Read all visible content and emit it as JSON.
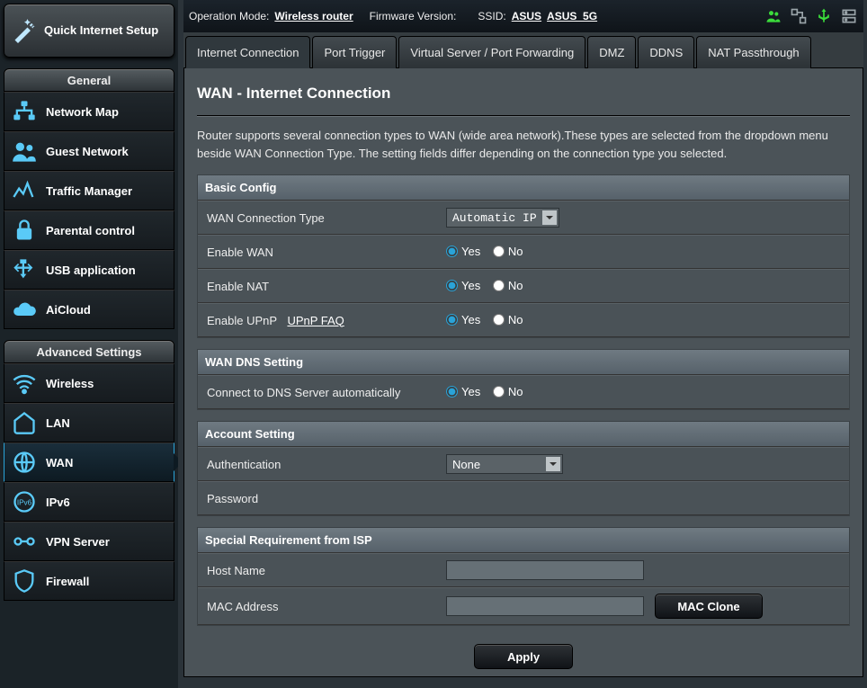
{
  "sidebar": {
    "qis_label": "Quick Internet Setup",
    "sections": {
      "general": {
        "title": "General",
        "items": [
          {
            "label": "Network Map",
            "icon": "network-map-icon"
          },
          {
            "label": "Guest Network",
            "icon": "guest-network-icon"
          },
          {
            "label": "Traffic Manager",
            "icon": "traffic-manager-icon"
          },
          {
            "label": "Parental control",
            "icon": "parental-control-icon"
          },
          {
            "label": "USB application",
            "icon": "usb-application-icon"
          },
          {
            "label": "AiCloud",
            "icon": "aicloud-icon"
          }
        ]
      },
      "advanced": {
        "title": "Advanced Settings",
        "items": [
          {
            "label": "Wireless",
            "icon": "wireless-icon"
          },
          {
            "label": "LAN",
            "icon": "lan-icon"
          },
          {
            "label": "WAN",
            "icon": "wan-icon",
            "active": true
          },
          {
            "label": "IPv6",
            "icon": "ipv6-icon"
          },
          {
            "label": "VPN Server",
            "icon": "vpn-server-icon"
          },
          {
            "label": "Firewall",
            "icon": "firewall-icon"
          }
        ]
      }
    }
  },
  "topbar": {
    "op_mode_label": "Operation Mode:",
    "op_mode_value": "Wireless router",
    "fw_label": "Firmware Version:",
    "ssid_label": "SSID:",
    "ssid_value_1": "ASUS",
    "ssid_value_2": "ASUS_5G"
  },
  "tabs": [
    {
      "label": "Internet Connection",
      "active": true
    },
    {
      "label": "Port Trigger"
    },
    {
      "label": "Virtual Server / Port Forwarding"
    },
    {
      "label": "DMZ"
    },
    {
      "label": "DDNS"
    },
    {
      "label": "NAT Passthrough"
    }
  ],
  "page": {
    "title": "WAN - Internet Connection",
    "description": "Router supports several connection types to WAN (wide area network).These types are selected from the dropdown menu beside WAN Connection Type. The setting fields differ depending on the connection type you selected.",
    "groups": {
      "basic": {
        "title": "Basic Config",
        "wan_type_label": "WAN Connection Type",
        "wan_type_value": "Automatic IP",
        "enable_wan_label": "Enable WAN",
        "enable_nat_label": "Enable NAT",
        "enable_upnp_label": "Enable UPnP",
        "upnp_faq": "UPnP FAQ"
      },
      "dns": {
        "title": "WAN DNS Setting",
        "auto_dns_label": "Connect to DNS Server automatically"
      },
      "account": {
        "title": "Account Setting",
        "auth_label": "Authentication",
        "auth_value": "None",
        "password_label": "Password"
      },
      "isp": {
        "title": "Special Requirement from ISP",
        "host_label": "Host Name",
        "mac_label": "MAC Address",
        "mac_clone_btn": "MAC Clone"
      }
    },
    "radio": {
      "yes": "Yes",
      "no": "No"
    },
    "apply": "Apply"
  }
}
